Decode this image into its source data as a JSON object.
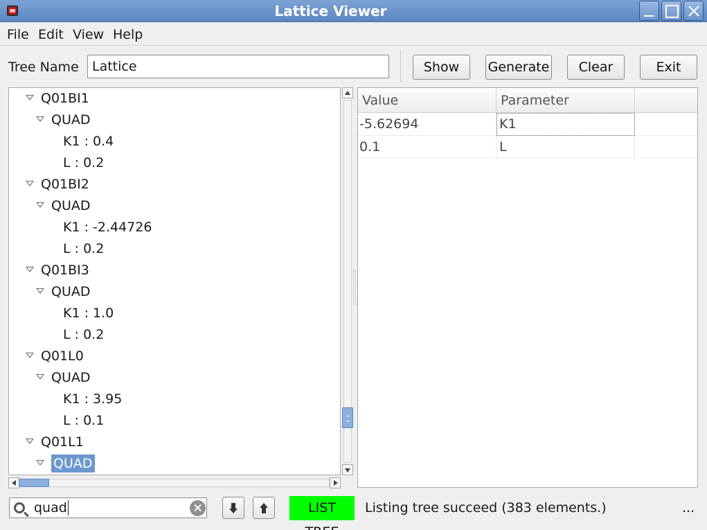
{
  "window": {
    "title": "Lattice Viewer"
  },
  "menubar": {
    "items": [
      "File",
      "Edit",
      "View",
      "Help"
    ]
  },
  "toolbar": {
    "tree_name_label": "Tree Name",
    "tree_name_value": "Lattice",
    "show_label": "Show",
    "generate_label": "Generate",
    "clear_label": "Clear",
    "exit_label": "Exit"
  },
  "tree": {
    "rows": [
      "Q01BI1",
      "QUAD",
      "K1 : 0.4",
      "L : 0.2",
      "Q01BI2",
      "QUAD",
      "K1 : -2.44726",
      "L : 0.2",
      "Q01BI3",
      "QUAD",
      "K1 : 1.0",
      "L : 0.2",
      "Q01L0",
      "QUAD",
      "K1 : 3.95",
      "L : 0.1",
      "Q01L1",
      "QUAD"
    ],
    "selected": "QUAD"
  },
  "table": {
    "headers": [
      "Value",
      "Parameter"
    ],
    "rows": [
      [
        "-5.62694",
        "K1"
      ],
      [
        "0.1",
        "L"
      ]
    ]
  },
  "search": {
    "value": "quad"
  },
  "status": {
    "badge": "LIST TREE",
    "badge_color": "#00ff00",
    "message": "Listing tree succeed (383 elements.)",
    "more": "..."
  },
  "colors": {
    "titlebar": "#6b93c9",
    "selection": "#6b97cf"
  },
  "icons": [
    "app-icon",
    "minimize-icon",
    "maximize-icon",
    "close-icon",
    "search-icon",
    "clear-icon",
    "down-arrow-icon",
    "up-arrow-icon",
    "expand-triangle-icon"
  ]
}
